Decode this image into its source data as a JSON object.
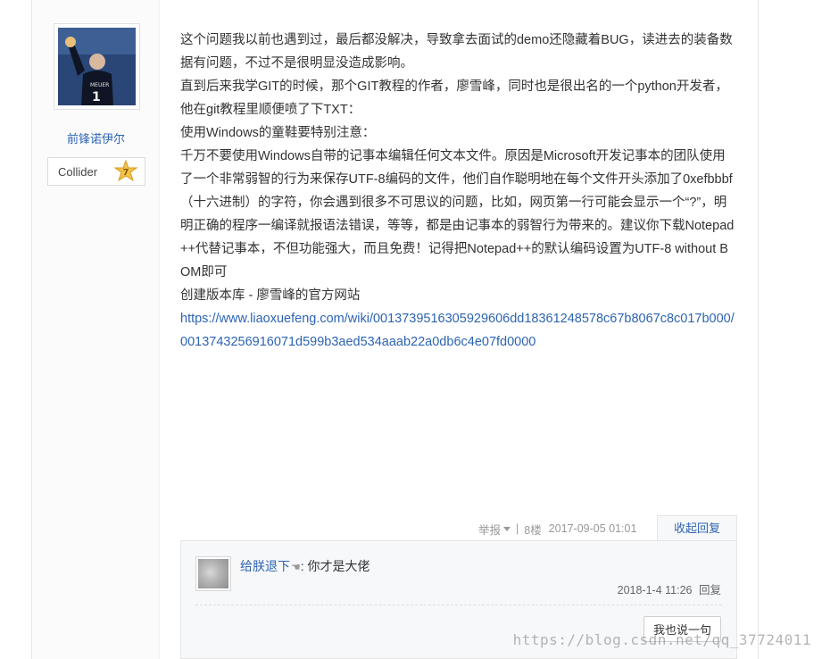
{
  "author": {
    "name": "前锋诺伊尔",
    "rank_name": "Collider",
    "rank_level": "7",
    "avatar_icon": "goalkeeper-photo"
  },
  "post": {
    "paragraphs": [
      "这个问题我以前也遇到过，最后都没解决，导致拿去面试的demo还隐藏着BUG，读进去的装备数据有问题，不过不是很明显没造成影响。",
      "直到后来我学GIT的时候，那个GIT教程的作者，廖雪峰，同时也是很出名的一个python开发者，他在git教程里顺便喷了下TXT：",
      "使用Windows的童鞋要特别注意：",
      "千万不要使用Windows自带的记事本编辑任何文本文件。原因是Microsoft开发记事本的团队使用了一个非常弱智的行为来保存UTF-8编码的文件，他们自作聪明地在每个文件开头添加了0xefbbbf（十六进制）的字符，你会遇到很多不可思议的问题，比如，网页第一行可能会显示一个“?”，明明正确的程序一编译就报语法错误，等等，都是由记事本的弱智行为带来的。建议你下载Notepad++代替记事本，不但功能强大，而且免费！记得把Notepad++的默认编码设置为UTF-8 without BOM即可",
      "创建版本库 - 廖雪峰的官方网站"
    ],
    "link": "https://www.liaoxuefeng.com/wiki/0013739516305929606dd18361248578c67b8067c8c017b000/0013743256916071d599b3aed534aaab22a0db6c4e07fd0000"
  },
  "meta": {
    "report_label": "举报",
    "separator": "|",
    "floor": "8楼",
    "datetime": "2017-09-05 01:01",
    "collapse_reply": "收起回复"
  },
  "reply": {
    "user": "给朕退下",
    "hand_icon": "☚",
    "colon": ":",
    "text": "你才是大佬",
    "time": "2018-1-4 11:26",
    "reply_label": "回复",
    "say_button": "我也说一句"
  },
  "watermark": "https://blog.csdn.net/qq_37724011",
  "colors": {
    "link": "#2d64b3",
    "text": "#333333",
    "muted": "#999999",
    "reply_bg": "#f7f8fa"
  }
}
